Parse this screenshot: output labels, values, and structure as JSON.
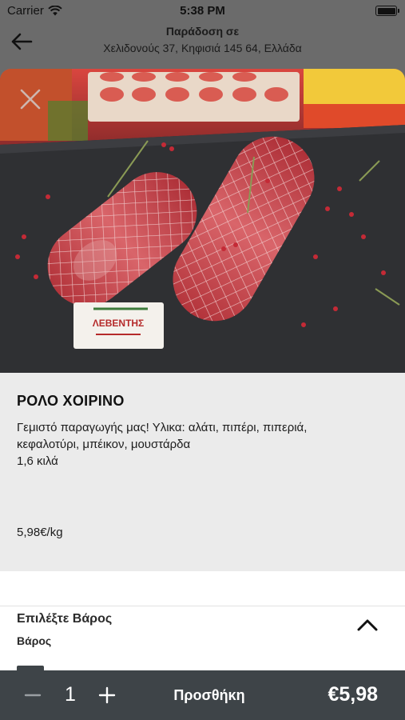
{
  "status_bar": {
    "carrier": "Carrier",
    "time": "5:38 PM"
  },
  "header": {
    "title": "Παράδοση σε",
    "address": "Χελιδονούς 37, Κηφισιά 145 64, Ελλάδα"
  },
  "product": {
    "name": "ΡΟΛΟ ΧΟΙΡΙΝΟ",
    "description_lines": [
      "Γεμιστό παραγωγής μας! Υλικα: αλάτι, πιπέρι, πιπεριά,",
      "κεφαλοτύρι, μπέικον, μουστάρδα",
      "1,6 κιλά"
    ],
    "unit_price": "5,98€/kg",
    "label_brand": "ΛΕΒΕΝΤΗΣ"
  },
  "weight_selector": {
    "title": "Επιλέξτε Βάρος",
    "subtitle": "Βάρος",
    "expanded": true
  },
  "cart_bar": {
    "quantity": "1",
    "add_label": "Προσθήκη",
    "total": "€5,98"
  },
  "colors": {
    "backdrop": "#6b6b6b",
    "sheet": "#ffffff",
    "info_panel": "#ebebeb",
    "bottom_bar": "#3e4448",
    "meat": "#c8464b"
  },
  "icons": [
    "wifi-icon",
    "battery-icon",
    "back-arrow-icon",
    "close-icon",
    "chevron-up-icon",
    "minus-icon",
    "plus-icon"
  ]
}
